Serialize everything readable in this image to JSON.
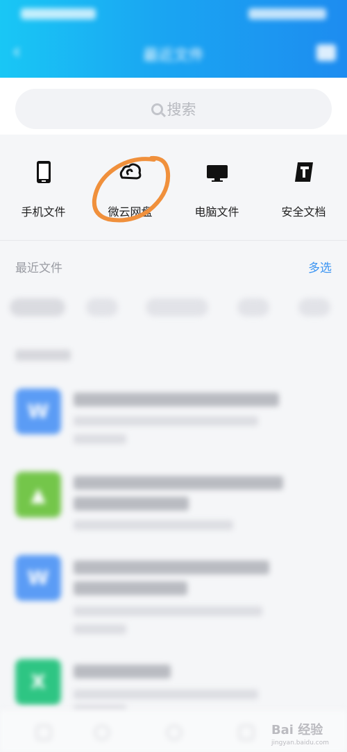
{
  "header": {
    "title": "最近文件",
    "back_glyph": "‹"
  },
  "search": {
    "placeholder": "搜索"
  },
  "categories": [
    {
      "label": "手机文件",
      "icon": "phone-icon"
    },
    {
      "label": "微云网盘",
      "icon": "cloud-icon"
    },
    {
      "label": "电脑文件",
      "icon": "monitor-icon"
    },
    {
      "label": "安全文档",
      "icon": "secure-doc-icon"
    }
  ],
  "recent": {
    "label": "最近文件",
    "multi_select": "多选"
  },
  "files": [
    {
      "icon": "word-file-icon",
      "color": "#5b9cf5",
      "glyph": "W"
    },
    {
      "icon": "apk-file-icon",
      "color": "#74c64a",
      "glyph": "▲"
    },
    {
      "icon": "word-file-icon",
      "color": "#5b9cf5",
      "glyph": "W"
    },
    {
      "icon": "excel-file-icon",
      "color": "#2ec583",
      "glyph": "X"
    }
  ],
  "watermark": {
    "text": "Bai 经验",
    "sub": "jingyan.baidu.com"
  },
  "colors": {
    "accent": "#3b94f2",
    "annotation": "#f0903c"
  }
}
